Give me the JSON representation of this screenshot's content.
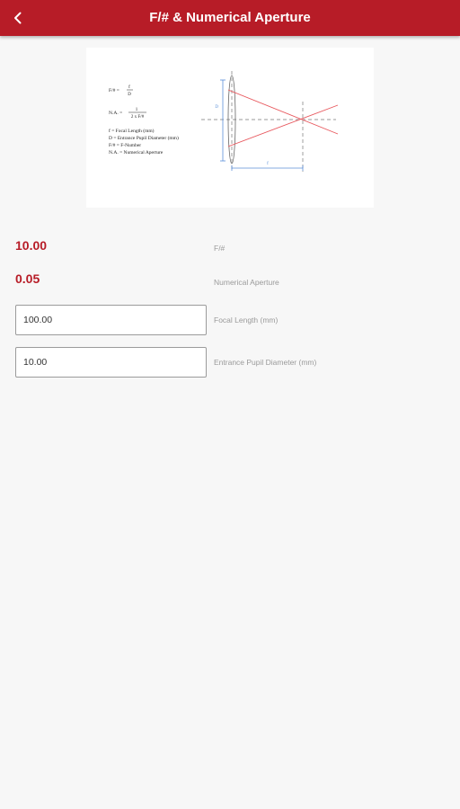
{
  "header": {
    "title": "F/# & Numerical Aperture",
    "back_icon": "chevron-left-icon"
  },
  "diagram": {
    "formula_fnumber_lhs": "F/# =",
    "formula_fnumber_num": "f",
    "formula_fnumber_den": "D",
    "formula_na_lhs": "N.A. =",
    "formula_na_num": "1",
    "formula_na_den": "2 x F/#",
    "legend": [
      "f = Focal Length (mm)",
      "D = Entrance Pupil Diameter (mm)",
      "F/# = F-Number",
      "N.A. = Numerical Aperture"
    ],
    "label_d": "D",
    "label_f": "f",
    "ray_color": "#e8585e",
    "dim_color": "#5b8fd9"
  },
  "results": {
    "fnumber_value": "10.00",
    "fnumber_label": "F/#",
    "na_value": "0.05",
    "na_label": "Numerical Aperture"
  },
  "inputs": {
    "focal_length_value": "100.00",
    "focal_length_label": "Focal Length (mm)",
    "pupil_diameter_value": "10.00",
    "pupil_diameter_label": "Entrance Pupil Diameter (mm)"
  },
  "colors": {
    "primary": "#b71c27",
    "background": "#f7f7f7",
    "label": "#9a9a9a"
  }
}
